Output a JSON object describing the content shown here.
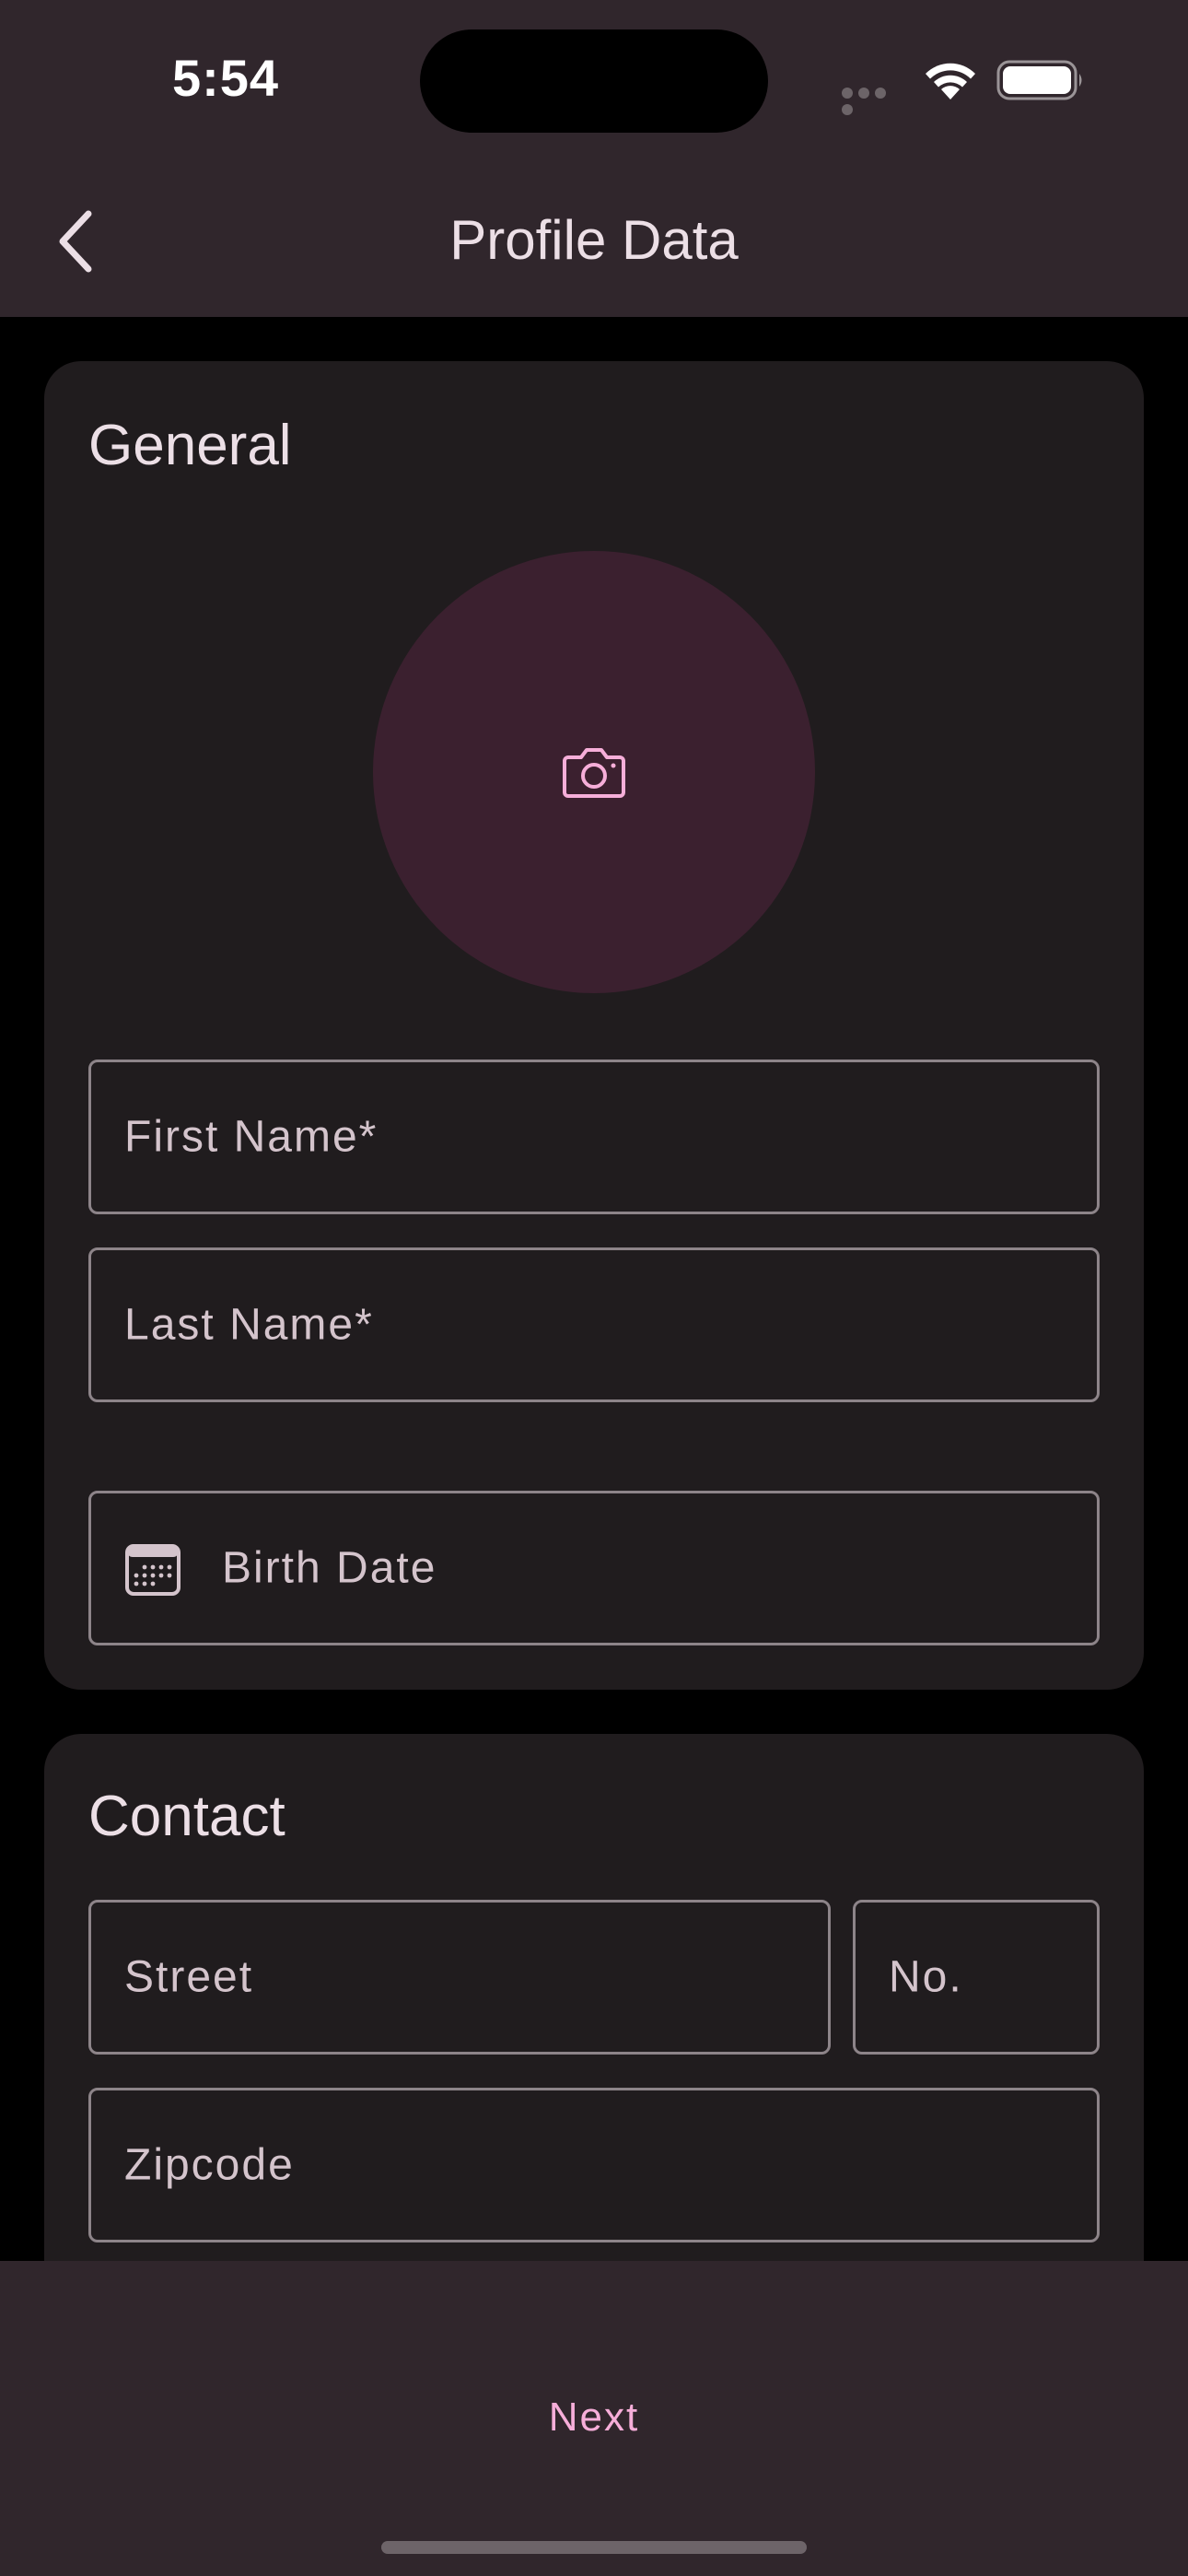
{
  "status_bar": {
    "time": "5:54"
  },
  "app_bar": {
    "title": "Profile Data",
    "back_icon": "chevron-left-icon"
  },
  "general": {
    "title": "General",
    "avatar_icon": "camera-icon",
    "fields": {
      "first_name": "First Name*",
      "last_name": "Last Name*",
      "birth_date": "Birth Date"
    },
    "birth_date_icon": "calendar-icon"
  },
  "contact": {
    "title": "Contact",
    "fields": {
      "street": "Street",
      "number": "No.",
      "zipcode": "Zipcode"
    }
  },
  "bottom_bar": {
    "next_label": "Next"
  },
  "colors": {
    "accent": "#f6aed9",
    "bar_background": "#30262c",
    "card_background": "#201c1e",
    "avatar_background": "#3b202f"
  }
}
